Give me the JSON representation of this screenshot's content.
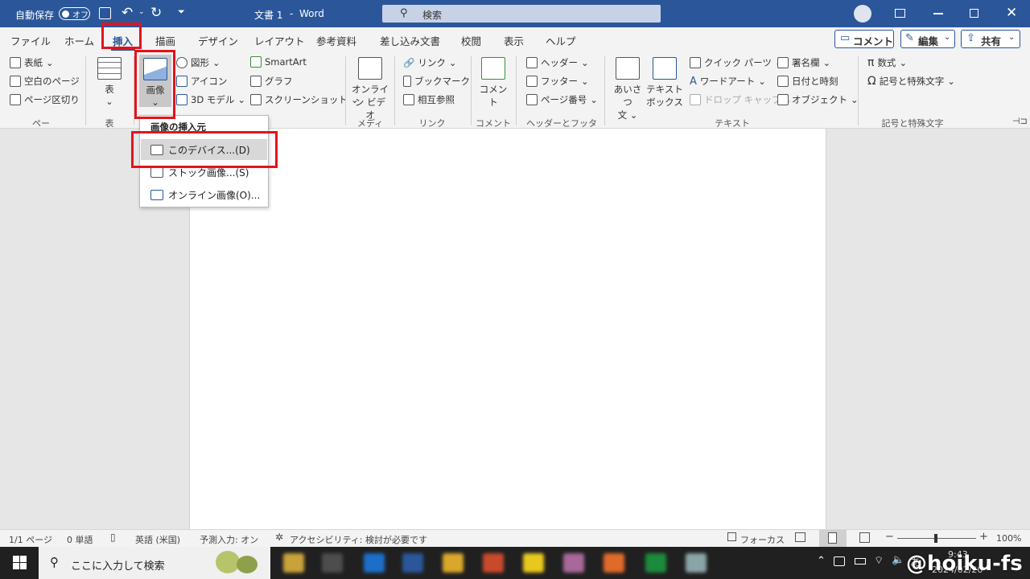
{
  "title_bar": {
    "autosave_label": "自動保存",
    "autosave_state": "オフ",
    "doc_title": "文書 1",
    "title_sep": "-",
    "app_name": "Word",
    "search_placeholder": "検索"
  },
  "tabs": [
    "ファイル",
    "ホーム",
    "挿入",
    "描画",
    "デザイン",
    "レイアウト",
    "参考資料",
    "差し込み文書",
    "校閲",
    "表示",
    "ヘルプ"
  ],
  "active_tab": "挿入",
  "top_right": {
    "comment": "コメント",
    "edit": "編集",
    "share": "共有"
  },
  "ribbon": {
    "pages": {
      "items": [
        "表紙",
        "空白のページ",
        "ページ区切り"
      ],
      "label": "ページ"
    },
    "table": {
      "button": "表",
      "label": "表"
    },
    "illustrations": {
      "image_button": "画像",
      "shapes": "図形",
      "icons": "アイコン",
      "model3d": "3D モデル",
      "smartart": "SmartArt",
      "chart": "グラフ",
      "screenshot": "スクリーンショット"
    },
    "media": {
      "button_line1": "オンライ",
      "button_line2": "ン ビデオ",
      "label": "メディア"
    },
    "links": {
      "items": [
        "リンク",
        "ブックマーク",
        "相互参照"
      ],
      "label": "リンク"
    },
    "comments": {
      "button": "コメント",
      "label": "コメント"
    },
    "header_footer": {
      "items": [
        "ヘッダー",
        "フッター",
        "ページ番号"
      ],
      "label": "ヘッダーとフッター"
    },
    "text": {
      "greeting_line1": "あいさつ",
      "greeting_line2": "文",
      "textbox_line1": "テキスト",
      "textbox_line2": "ボックス",
      "quickparts": "クイック パーツ",
      "wordart": "ワードアート",
      "dropcap": "ドロップ キャップ",
      "signature": "署名欄",
      "datetime": "日付と時刻",
      "object": "オブジェクト",
      "label": "テキスト"
    },
    "symbols": {
      "equation": "数式",
      "symbol": "記号と特殊文字",
      "label": "記号と特殊文字"
    }
  },
  "image_menu": {
    "header": "画像の挿入元",
    "items": [
      "このデバイス...(D)",
      "ストック画像...(S)",
      "オンライン画像(O)..."
    ]
  },
  "status": {
    "page": "1/1 ページ",
    "words": "0 単語",
    "lang": "英語 (米国)",
    "predict": "予測入力: オン",
    "accessibility": "アクセシビリティ: 検討が必要です",
    "focus": "フォーカス",
    "zoom": "100%"
  },
  "taskbar": {
    "search_placeholder": "ここに入力して検索",
    "time": "9:43",
    "date": "2024/02/20"
  },
  "watermark": "@hoiku-fs",
  "colors": {
    "accent": "#2b579a",
    "highlight": "#e2141b"
  }
}
